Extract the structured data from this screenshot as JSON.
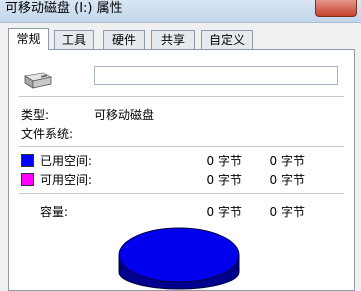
{
  "window": {
    "title": "可移动磁盘 (I:) 属性"
  },
  "tabs": [
    {
      "label": "常规",
      "active": true
    },
    {
      "label": "工具",
      "active": false
    },
    {
      "label": "硬件",
      "active": false
    },
    {
      "label": "共享",
      "active": false
    },
    {
      "label": "自定义",
      "active": false
    }
  ],
  "general": {
    "name_value": "",
    "type_label": "类型:",
    "type_value": "可移动磁盘",
    "fs_label": "文件系统:",
    "fs_value": "",
    "used": {
      "label": "已用空间:",
      "bytes": "0 字节",
      "size": "0 字节",
      "color": "#0000ff"
    },
    "free": {
      "label": "可用空间:",
      "bytes": "0 字节",
      "size": "0 字节",
      "color": "#ff00ff"
    },
    "capacity": {
      "label": "容量:",
      "bytes": "0 字节",
      "size": "0 字节"
    }
  },
  "colors": {
    "pie_top": "#0000ee",
    "pie_side": "#00008e",
    "pie_outline": "#000040"
  }
}
